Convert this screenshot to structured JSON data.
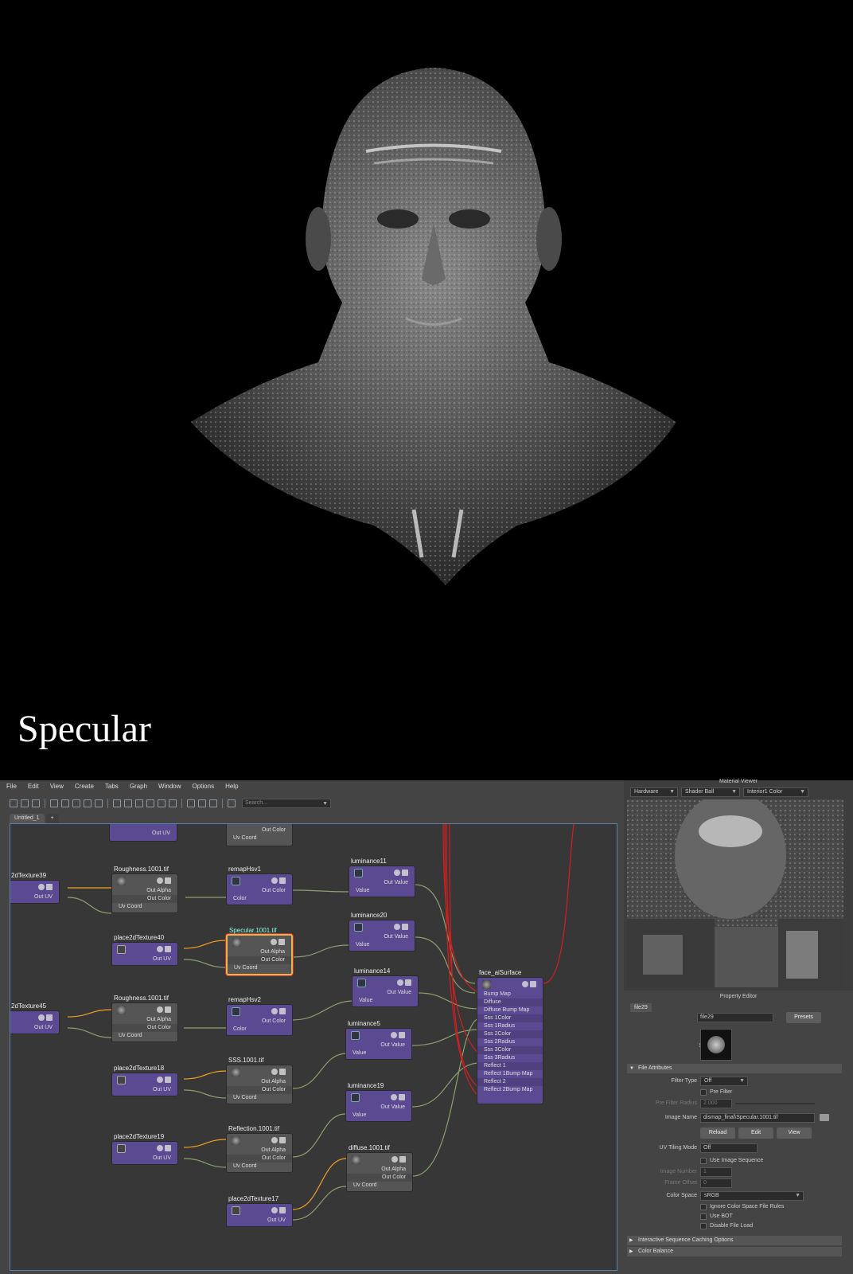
{
  "caption": "Specular",
  "menu": [
    "File",
    "Edit",
    "View",
    "Create",
    "Tabs",
    "Graph",
    "Window",
    "Options",
    "Help"
  ],
  "search_placeholder": "Search...",
  "tabs": [
    "Untitled_1",
    "+"
  ],
  "nodes": {
    "place_top": {
      "out_uv": "Out UV"
    },
    "remap_top": {
      "uv": "Uv Coord",
      "out_color": "Out Color"
    },
    "place39": {
      "title": "2dTexture39",
      "out_uv": "Out UV"
    },
    "rough1": {
      "title": "Roughness.1001.tif",
      "out_alpha": "Out Alpha",
      "out_color": "Out Color",
      "uv": "Uv Coord"
    },
    "remap1": {
      "title": "remapHsv1",
      "out_color": "Out Color",
      "color": "Color"
    },
    "lum11": {
      "title": "luminance11",
      "out_value": "Out Value",
      "value": "Value"
    },
    "place40": {
      "title": "place2dTexture40",
      "out_uv": "Out UV"
    },
    "spec": {
      "title": "Specular.1001.tif",
      "out_alpha": "Out Alpha",
      "out_color": "Out Color",
      "uv": "Uv Coord"
    },
    "lum20": {
      "title": "luminance20",
      "out_value": "Out Value",
      "value": "Value"
    },
    "lum14": {
      "title": "luminance14",
      "out_value": "Out Value",
      "value": "Value"
    },
    "place45": {
      "title": "2dTexture45",
      "out_uv": "Out UV"
    },
    "rough2": {
      "title": "Roughness.1001.tif",
      "out_alpha": "Out Alpha",
      "out_color": "Out Color",
      "uv": "Uv Coord"
    },
    "remap2": {
      "title": "remapHsv2",
      "out_color": "Out Color",
      "color": "Color"
    },
    "lum5": {
      "title": "luminance5",
      "out_value": "Out Value",
      "value": "Value"
    },
    "place18": {
      "title": "place2dTexture18",
      "out_uv": "Out UV"
    },
    "sss": {
      "title": "SSS.1001.tif",
      "out_alpha": "Out Alpha",
      "out_color": "Out Color",
      "uv": "Uv Coord"
    },
    "lum19": {
      "title": "luminance19",
      "out_value": "Out Value",
      "value": "Value"
    },
    "place19": {
      "title": "place2dTexture19",
      "out_uv": "Out UV"
    },
    "refl": {
      "title": "Reflection.1001.tif",
      "out_alpha": "Out Alpha",
      "out_color": "Out Color",
      "uv": "Uv Coord"
    },
    "diffuse": {
      "title": "diffuse.1001.tif",
      "out_alpha": "Out Alpha",
      "out_color": "Out Color",
      "uv": "Uv Coord"
    },
    "place17": {
      "title": "place2dTexture17",
      "out_uv": "Out UV"
    },
    "surface": {
      "title": "face_aiSurface",
      "attrs": [
        "Bump Map",
        "Diffuse",
        "Diffuse Bump Map",
        "Sss 1Color",
        "Sss 1Radius",
        "Sss 2Color",
        "Sss 2Radius",
        "Sss 3Color",
        "Sss 3Radius",
        "Reflect 1",
        "Reflect 1Bump Map",
        "Reflect 2",
        "Reflect 2Bump Map"
      ]
    }
  },
  "material_viewer": {
    "label": "Material Viewer",
    "renderer": "Hardware",
    "shape": "Shader Ball",
    "env": "Interior1 Color"
  },
  "property_editor": {
    "label": "Property Editor",
    "tab": "file29",
    "file_label": "file:",
    "file_value": "file29",
    "presets": "Presets",
    "sample": "Sample",
    "section_file": "File Attributes",
    "filter_type_label": "Filter Type",
    "filter_type": "Off",
    "pre_filter": "Pre Filter",
    "pre_filter_radius_label": "Pre Filter Radius",
    "pre_filter_radius": "2.000",
    "image_name_label": "Image Name",
    "image_name": "dismap_final\\Specular.1001.tif",
    "reload": "Reload",
    "edit": "Edit",
    "view": "View",
    "uv_tiling_label": "UV Tiling Mode",
    "uv_tiling": "Off",
    "use_seq": "Use Image Sequence",
    "image_number_label": "Image Number",
    "image_number": "1",
    "frame_offset_label": "Frame Offset",
    "frame_offset": "0",
    "color_space_label": "Color Space",
    "color_space": "sRGB",
    "ignore_rules": "Ignore Color Space File Rules",
    "use_bot": "Use BOT",
    "disable_load": "Disable File Load",
    "section_cache": "Interactive Sequence Caching Options",
    "section_color": "Color Balance"
  },
  "colors": {
    "accent": "#5b4a92",
    "connection_out": "#f0a020",
    "connection_red": "#d02020",
    "selection": "#e8b54a"
  }
}
